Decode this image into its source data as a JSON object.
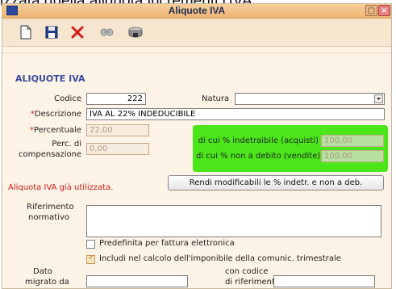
{
  "doc_text": "izzata quella aliquota incrementi l'IVA",
  "window": {
    "title": "Aliquote IVA"
  },
  "section": {
    "title": "ALIQUOTE IVA"
  },
  "fields": {
    "codice": {
      "label": "Codice",
      "value": "222"
    },
    "natura": {
      "label": "Natura",
      "value": ""
    },
    "descrizione": {
      "label": "Descrizione",
      "required_mark": "*",
      "value": "IVA AL 22% INDEDUCIBILE"
    },
    "percentuale": {
      "label": "Percentuale",
      "required_mark": "*",
      "value": "22,00"
    },
    "perc_compensazione": {
      "label_line1": "Perc. di",
      "label_line2": "compensazione",
      "value": "0,00"
    },
    "indetraibile": {
      "label": "di cui % indetraibile (acquisti)",
      "value": "100,00"
    },
    "non_a_debito": {
      "label": "di cui % non a debito (vendite)",
      "value": "100,00"
    },
    "riferimento": {
      "label_line1": "Riferimento",
      "label_line2": "normativo",
      "value": ""
    },
    "dato_migrato": {
      "label_line1": "Dato",
      "label_line2": "migrato da"
    },
    "codice_riferimento": {
      "label_line1": "con codice",
      "label_line2": "di riferimento"
    }
  },
  "messages": {
    "already_used": "Aliquota IVA già utilizzata."
  },
  "buttons": {
    "rendi_modificabili": "Rendi modificabili le % indetr. e non a deb."
  },
  "checkboxes": {
    "predefinita": {
      "label": "Predefinita per fattura elettronica",
      "checked": false
    },
    "includi": {
      "label": "Includi nel calcolo dell'imponibile della comunic. trimestrale",
      "checked": true
    }
  },
  "colors": {
    "highlight": "#4be61a",
    "required": "#d01818",
    "section_title": "#3a4ba0"
  }
}
